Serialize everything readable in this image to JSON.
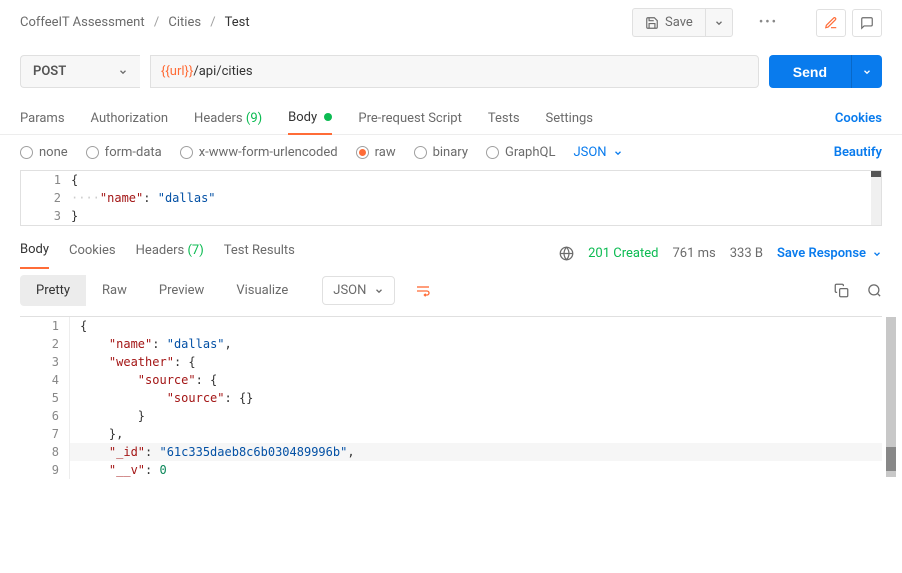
{
  "breadcrumb": {
    "root": "CoffeeIT Assessment",
    "mid": "Cities",
    "leaf": "Test"
  },
  "actions": {
    "save": "Save"
  },
  "request": {
    "method": "POST",
    "url_var": "{{url}}",
    "url_path": "/api/cities",
    "send": "Send"
  },
  "req_tabs": {
    "params": "Params",
    "auth": "Authorization",
    "headers_label": "Headers",
    "headers_count": "(9)",
    "body": "Body",
    "prereq": "Pre-request Script",
    "tests": "Tests",
    "settings": "Settings",
    "cookies": "Cookies"
  },
  "body_opts": {
    "none": "none",
    "form": "form-data",
    "xwww": "x-www-form-urlencoded",
    "raw": "raw",
    "binary": "binary",
    "graphql": "GraphQL",
    "fmt": "JSON",
    "beautify": "Beautify"
  },
  "req_body_lines": {
    "l1": "{",
    "l2a": "····",
    "l2k": "\"name\"",
    "l2c": ": ",
    "l2v": "\"dallas\"",
    "l3": "}"
  },
  "resp_tabs": {
    "body": "Body",
    "cookies": "Cookies",
    "headers_label": "Headers",
    "headers_count": "(7)",
    "tests": "Test Results"
  },
  "resp_meta": {
    "status": "201 Created",
    "time": "761 ms",
    "size": "333 B",
    "save": "Save Response"
  },
  "resp_view": {
    "pretty": "Pretty",
    "raw": "Raw",
    "preview": "Preview",
    "visualize": "Visualize",
    "fmt": "JSON"
  },
  "resp_body": {
    "l1": "{",
    "l2_k": "\"name\"",
    "l2_v": "\"dallas\"",
    "l3_k": "\"weather\"",
    "l4_k": "\"source\"",
    "l5_k": "\"source\"",
    "l8_k": "\"_id\"",
    "l8_v": "\"61c335daeb8c6b030489996b\"",
    "l9_k": "\"__v\"",
    "l9_v": "0"
  }
}
